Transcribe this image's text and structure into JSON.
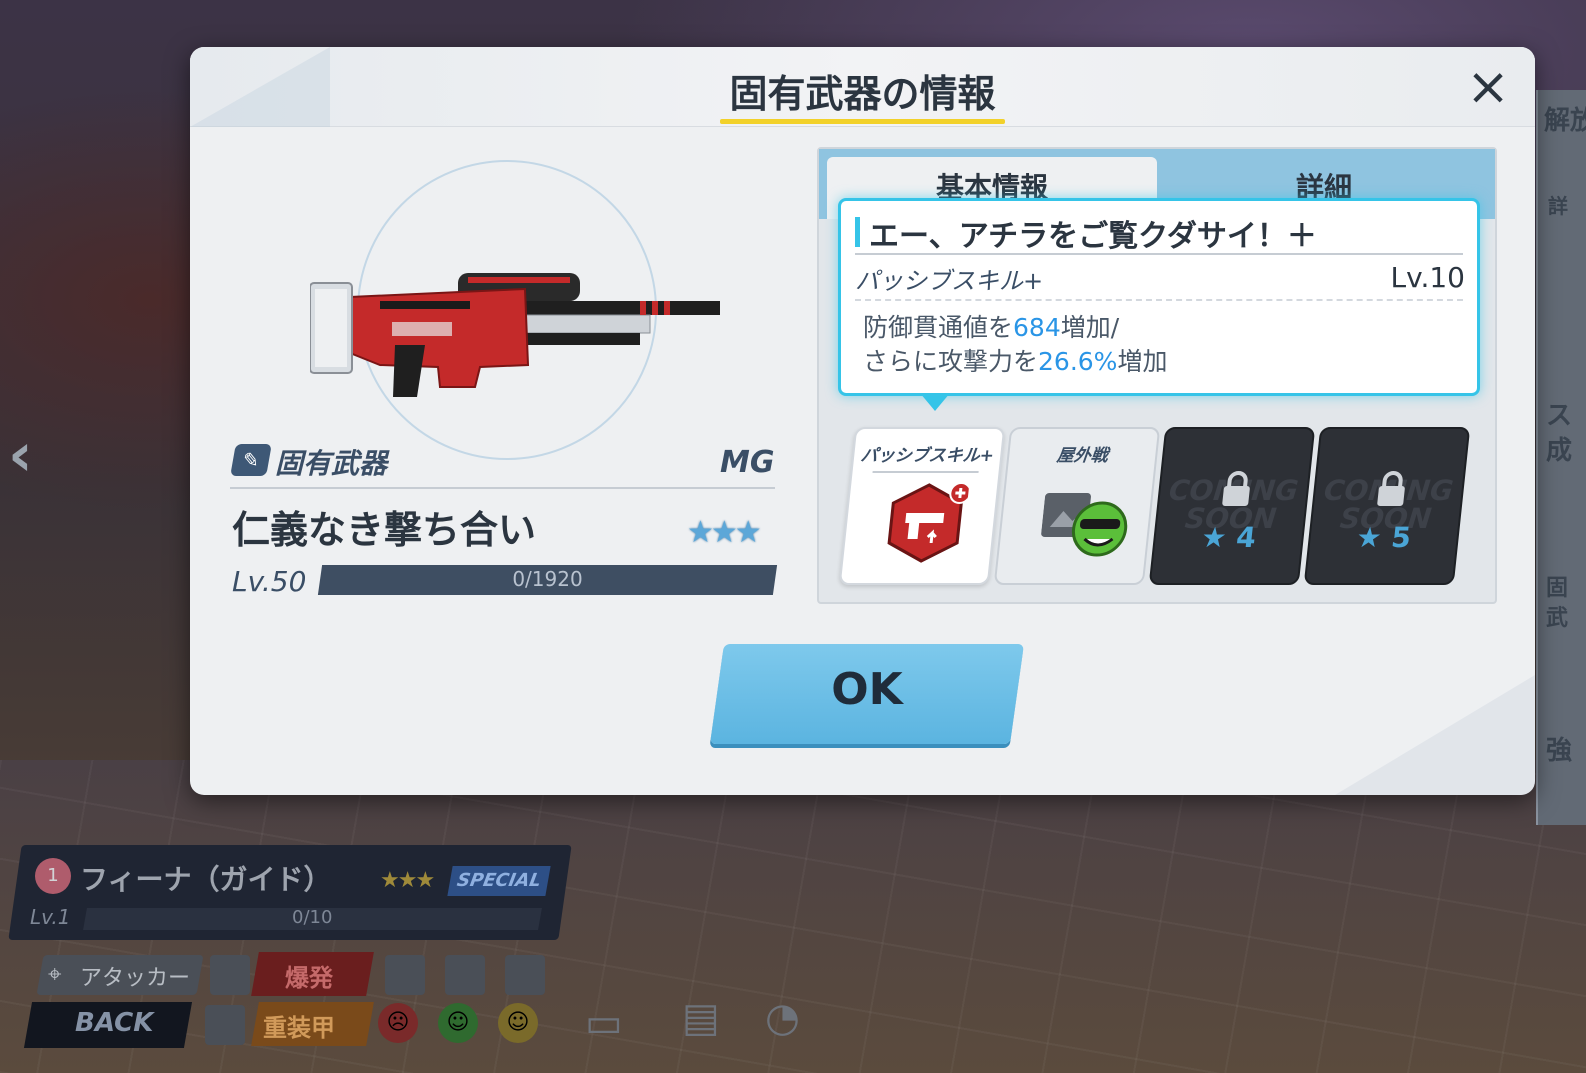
{
  "modal": {
    "title": "固有武器の情報",
    "close_icon": "×"
  },
  "weapon": {
    "category_label": "固有武器",
    "type": "MG",
    "name": "仁義なき撃ち合い",
    "stars": "★★★",
    "level": "Lv.50",
    "exp_text": "0/1920"
  },
  "tabs": [
    {
      "label": "基本情報",
      "active": true
    },
    {
      "label": "詳細",
      "active": false
    }
  ],
  "tooltip": {
    "title": "エー、アチラをご覧クダサイ！＋",
    "subtitle": "パッシブスキル+",
    "level": "Lv.10",
    "desc_line1_a": "防御貫通値を",
    "desc_line1_b": "684",
    "desc_line1_c": "増加/",
    "desc_line2_a": "さらに攻撃力を",
    "desc_line2_b": "26.6%",
    "desc_line2_c": "増加"
  },
  "skill_cards": [
    {
      "title": "パッシブスキル+",
      "state": "selected"
    },
    {
      "title": "屋外戦",
      "state": "normal"
    },
    {
      "title": "",
      "state": "locked",
      "coming": "COMING SOON",
      "star": "★",
      "num": "4"
    },
    {
      "title": "",
      "state": "locked",
      "coming": "COMING SOON",
      "star": "★",
      "num": "5"
    }
  ],
  "ok_label": "OK",
  "character": {
    "affection": "1",
    "name": "フィーナ（ガイド）",
    "stars": "★★★",
    "badge": "SPECIAL",
    "level": "Lv.1",
    "exp": "0/10",
    "role": "アタッカー",
    "attack_type": "爆発",
    "armor_type": "重装甲"
  },
  "back_label": "BACK",
  "side_panel_text": [
    "解放",
    "詳",
    "ス",
    "成",
    "固",
    "武",
    "強"
  ],
  "colors": {
    "accent_blue": "#35c4e8",
    "highlight": "#2a95e6",
    "ok_button": "#5bb4e0",
    "title_underline": "#f2d12a"
  }
}
